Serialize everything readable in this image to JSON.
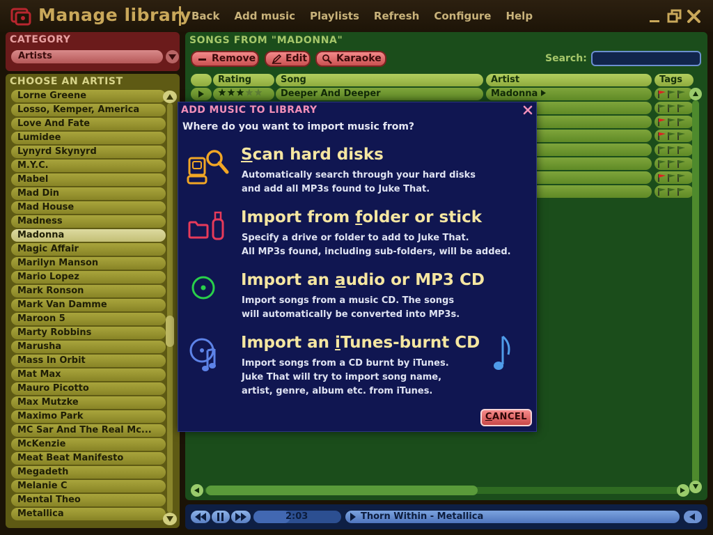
{
  "app": {
    "title": "Manage library",
    "menu": [
      "Back",
      "Add music",
      "Playlists",
      "Refresh",
      "Configure",
      "Help"
    ]
  },
  "category": {
    "label": "CATEGORY",
    "selected": "Artists"
  },
  "artists": {
    "label": "CHOOSE AN ARTIST",
    "selected": "Madonna",
    "items": [
      "Lorne Greene",
      "Losso, Kemper, America",
      "Love And Fate",
      "Lumidee",
      "Lynyrd Skynyrd",
      "M.Y.C.",
      "Mabel",
      "Mad Din",
      "Mad House",
      "Madness",
      "Madonna",
      "Magic Affair",
      "Marilyn Manson",
      "Mario Lopez",
      "Mark Ronson",
      "Mark Van Damme",
      "Maroon 5",
      "Marty Robbins",
      "Marusha",
      "Mass In Orbit",
      "Mat Max",
      "Mauro Picotto",
      "Max Mutzke",
      "Maximo Park",
      "MC Sar And The Real Mc...",
      "McKenzie",
      "Meat Beat Manifesto",
      "Megadeth",
      "Melanie C",
      "Mental Theo",
      "Metallica"
    ]
  },
  "songs": {
    "label": "SONGS FROM \"MADONNA\"",
    "toolbar": {
      "remove": "Remove",
      "edit": "Edit",
      "karaoke": "Karaoke"
    },
    "search": {
      "label": "Search:",
      "value": ""
    },
    "columns": [
      "Rating",
      "Song",
      "Artist",
      "Tags"
    ],
    "first_row": {
      "rating": 3,
      "rating_max": 5,
      "song": "Deeper And Deeper",
      "artist": "Madonna"
    },
    "visible_rows": 8
  },
  "player": {
    "time": "2:03",
    "progress": 0.42,
    "now_playing": "Thorn Within - Metallica"
  },
  "dialog": {
    "title": "ADD MUSIC TO LIBRARY",
    "question": "Where do you want to import music from?",
    "options": [
      {
        "title_pre": "",
        "title_key": "S",
        "title_post": "can hard disks",
        "desc1": "Automatically search through your hard disks",
        "desc2": "and add all MP3s found to Juke That.",
        "desc3": ""
      },
      {
        "title_pre": "Import from ",
        "title_key": "f",
        "title_post": "older or stick",
        "desc1": "Specify a drive or folder to add to Juke That.",
        "desc2": "All MP3s found, including sub-folders, will be added.",
        "desc3": ""
      },
      {
        "title_pre": "Import an ",
        "title_key": "a",
        "title_post": "udio or MP3 CD",
        "desc1": "Import songs from a music CD. The songs",
        "desc2": "will automatically be converted into MP3s.",
        "desc3": ""
      },
      {
        "title_pre": "Import an ",
        "title_key": "i",
        "title_post": "Tunes-burnt CD",
        "desc1": "Import songs from a CD burnt by iTunes.",
        "desc2": "Juke That will try to import song name,",
        "desc3": "artist, genre, album etc. from iTunes."
      }
    ],
    "cancel_key": "C",
    "cancel_rest": "ANCEL"
  },
  "colors": {
    "accent_gold": "#c9a85a",
    "dialog_bg": "#101651",
    "dialog_title": "#f28fb8",
    "option_title": "#f5e6a1",
    "category_panel": "#6b1b1b",
    "artist_panel": "#5e5a14",
    "songs_panel": "#1b4d1b"
  }
}
